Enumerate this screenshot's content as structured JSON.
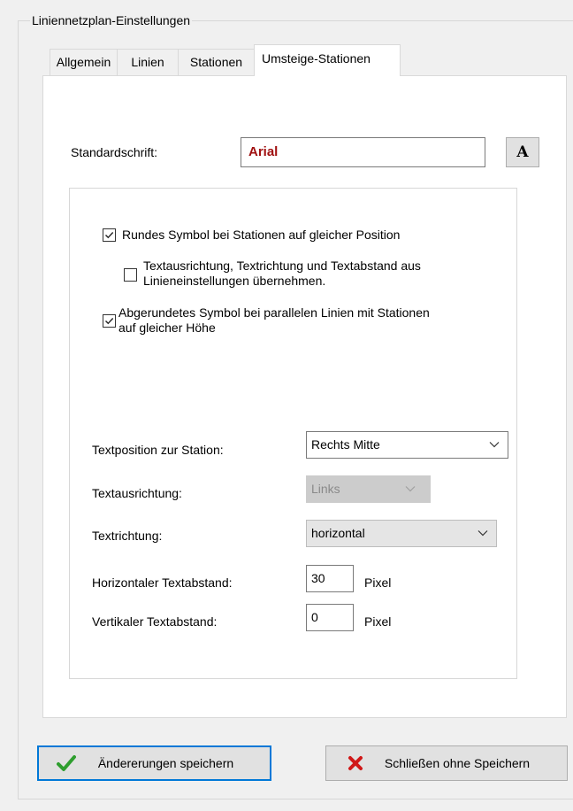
{
  "group": {
    "title": "Liniennetzplan-Einstellungen"
  },
  "tabs": [
    {
      "label": "Allgemein"
    },
    {
      "label": "Linien"
    },
    {
      "label": "Stationen"
    },
    {
      "label": "Umsteige-Stationen",
      "active": true
    }
  ],
  "font": {
    "label": "Standardschrift:",
    "value": "Arial",
    "button_glyph": "A",
    "value_color": "#a01010"
  },
  "options": {
    "round_symbol": {
      "label": "Rundes Symbol bei Stationen auf gleicher Position",
      "checked": true
    },
    "inherit_text": {
      "lines": [
        "Textausrichtung, Textrichtung und Textabstand aus",
        "Linieneinstellungen übernehmen."
      ],
      "checked": false
    },
    "rounded_parallel": {
      "lines": [
        "Abgerundetes Symbol bei parallelen Linien mit Stationen",
        "auf gleicher Höhe"
      ],
      "checked": true
    }
  },
  "fields": {
    "text_position": {
      "label": "Textposition zur Station:",
      "value": "Rechts Mitte"
    },
    "text_alignment": {
      "label": "Textausrichtung:",
      "value": "Links",
      "disabled": true
    },
    "text_direction": {
      "label": "Textrichtung:",
      "value": "horizontal"
    },
    "h_spacing": {
      "label": "Horizontaler Textabstand:",
      "value": "30",
      "unit": "Pixel"
    },
    "v_spacing": {
      "label": "Vertikaler Textabstand:",
      "value": "0",
      "unit": "Pixel"
    }
  },
  "buttons": {
    "save": {
      "label": "Ändererungen speichern",
      "icon": "checkmark-icon",
      "color": "#2e9e2e"
    },
    "close": {
      "label": "Schließen ohne Speichern",
      "icon": "red-x-icon",
      "color": "#d01818"
    }
  },
  "colors": {
    "accent": "#0078d7",
    "window_bg": "#f0f0f0"
  }
}
